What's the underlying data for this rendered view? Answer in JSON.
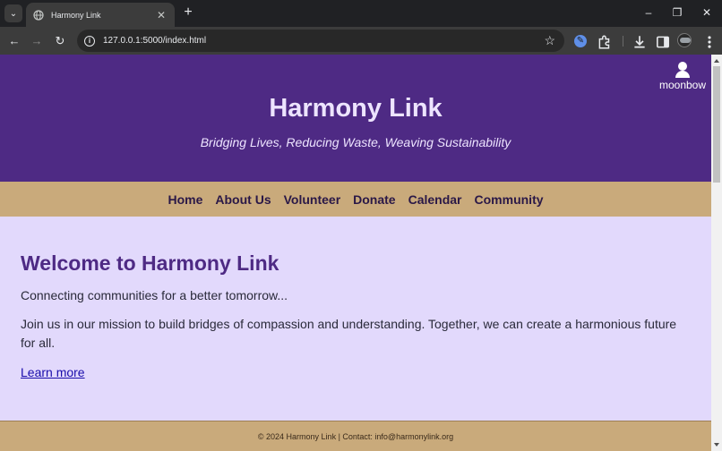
{
  "browser": {
    "tab_title": "Harmony Link",
    "tab_close_glyph": "✕",
    "new_tab_glyph": "+",
    "url": "127.0.0.1:5000/index.html",
    "minimize_glyph": "–",
    "restore_glyph": "❐",
    "close_glyph": "✕",
    "back_glyph": "←",
    "forward_glyph": "→",
    "reload_glyph": "↻",
    "star_glyph": "☆",
    "info_glyph": "i",
    "search_tabs_glyph": "⌄"
  },
  "header": {
    "title": "Harmony Link",
    "tagline": "Bridging Lives, Reducing Waste, Weaving Sustainability",
    "username": "moonbow"
  },
  "nav": {
    "items": [
      "Home",
      "About Us",
      "Volunteer",
      "Donate",
      "Calendar",
      "Community"
    ]
  },
  "main": {
    "heading": "Welcome to Harmony Link",
    "lead": "Connecting communities for a better tomorrow...",
    "mission": "Join us in our mission to build bridges of compassion and understanding. Together, we can create a harmonious future for all.",
    "learn_more": "Learn more"
  },
  "footer": {
    "text": "© 2024 Harmony Link | Contact: info@harmonylink.org"
  },
  "colors": {
    "header_bg": "#4e2a84",
    "nav_bg": "#c9aa7b",
    "content_bg": "#e2d9fc",
    "link": "#1a0dab"
  }
}
